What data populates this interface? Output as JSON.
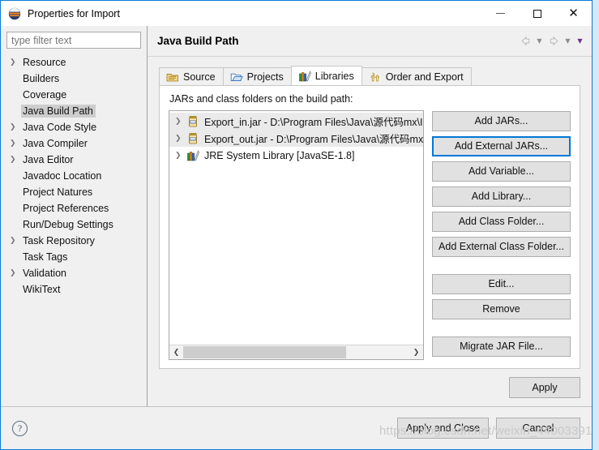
{
  "window": {
    "title": "Properties for Import",
    "logo_icon": "eclipse-logo-icon",
    "minimize_label": "Minimize",
    "maximize_label": "Maximize",
    "close_label": "Close"
  },
  "sidebar": {
    "filter": {
      "value": "",
      "placeholder": "type filter text"
    },
    "items": [
      {
        "label": "Resource",
        "expandable": true,
        "selected": false
      },
      {
        "label": "Builders",
        "expandable": false,
        "selected": false
      },
      {
        "label": "Coverage",
        "expandable": false,
        "selected": false
      },
      {
        "label": "Java Build Path",
        "expandable": false,
        "selected": true
      },
      {
        "label": "Java Code Style",
        "expandable": true,
        "selected": false
      },
      {
        "label": "Java Compiler",
        "expandable": true,
        "selected": false
      },
      {
        "label": "Java Editor",
        "expandable": true,
        "selected": false
      },
      {
        "label": "Javadoc Location",
        "expandable": false,
        "selected": false
      },
      {
        "label": "Project Natures",
        "expandable": false,
        "selected": false
      },
      {
        "label": "Project References",
        "expandable": false,
        "selected": false
      },
      {
        "label": "Run/Debug Settings",
        "expandable": false,
        "selected": false
      },
      {
        "label": "Task Repository",
        "expandable": true,
        "selected": false
      },
      {
        "label": "Task Tags",
        "expandable": false,
        "selected": false
      },
      {
        "label": "Validation",
        "expandable": true,
        "selected": false
      },
      {
        "label": "WikiText",
        "expandable": false,
        "selected": false
      }
    ]
  },
  "content": {
    "page_title": "Java Build Path",
    "nav": {
      "back_icon": "back-arrow-icon",
      "back_menu_icon": "chevron-down-icon",
      "forward_icon": "forward-arrow-icon",
      "forward_menu_icon": "chevron-down-icon",
      "view_menu_icon": "chevron-down-icon"
    },
    "tabs": [
      {
        "label": "Source",
        "icon": "source-folder-icon",
        "active": false
      },
      {
        "label": "Projects",
        "icon": "projects-folder-icon",
        "active": false
      },
      {
        "label": "Libraries",
        "icon": "libraries-books-icon",
        "active": true
      },
      {
        "label": "Order and Export",
        "icon": "order-export-icon",
        "active": false
      }
    ],
    "panel_caption": "JARs and class folders on the build path:",
    "list_items": [
      {
        "text": "Export_in.jar - D:\\Program Files\\Java\\源代码mx\\Imp",
        "icon": "jar-icon",
        "expandable": true,
        "selected": true
      },
      {
        "text": "Export_out.jar - D:\\Program Files\\Java\\源代码mx\\In",
        "icon": "jar-icon",
        "expandable": true,
        "selected": true
      },
      {
        "text": "JRE System Library [JavaSE-1.8]",
        "icon": "libraries-books-icon",
        "expandable": true,
        "selected": false
      }
    ],
    "scrollbar": {
      "left_arrow_icon": "chevron-left-icon",
      "right_arrow_icon": "chevron-right-icon",
      "thumb_percent": 72
    },
    "buttons": [
      {
        "label": "Add JARs...",
        "focused": false,
        "gap_after": false
      },
      {
        "label": "Add External JARs...",
        "focused": true,
        "gap_after": false
      },
      {
        "label": "Add Variable...",
        "focused": false,
        "gap_after": false
      },
      {
        "label": "Add Library...",
        "focused": false,
        "gap_after": false
      },
      {
        "label": "Add Class Folder...",
        "focused": false,
        "gap_after": false
      },
      {
        "label": "Add External Class Folder...",
        "focused": false,
        "gap_after": true
      },
      {
        "label": "Edit...",
        "focused": false,
        "gap_after": false
      },
      {
        "label": "Remove",
        "focused": false,
        "gap_after": true
      },
      {
        "label": "Migrate JAR File...",
        "focused": false,
        "gap_after": false
      }
    ],
    "apply_label": "Apply"
  },
  "footer": {
    "help_icon": "help-question-icon",
    "help_glyph": "?",
    "apply_and_close_label": "Apply and Close",
    "cancel_label": "Cancel"
  },
  "watermark": {
    "text": "https://blog.csdn.net/weixin_44003391"
  },
  "colors": {
    "window_border": "#0a7cd6",
    "dialog_bg": "#f0f0f0",
    "focus_blue": "#0078d7",
    "selection_grey": "#cdcdcd"
  }
}
